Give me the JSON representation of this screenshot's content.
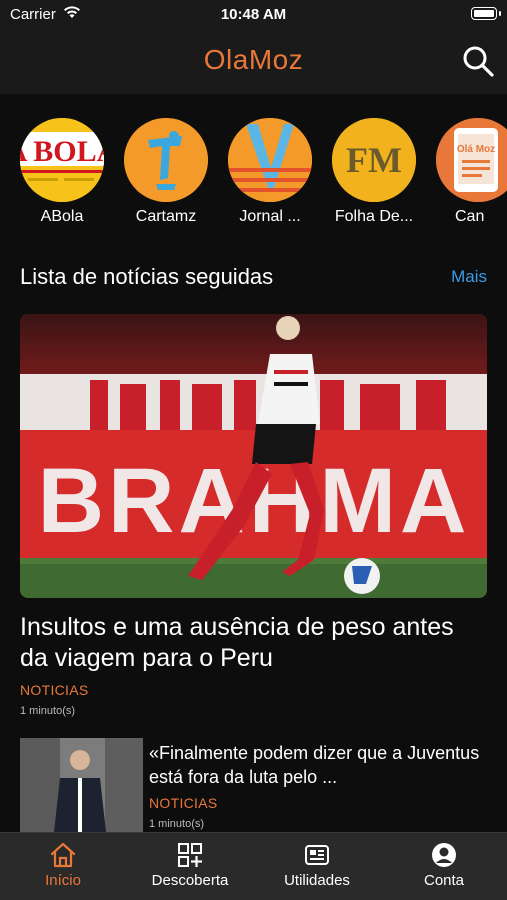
{
  "status_bar": {
    "carrier": "Carrier",
    "time": "10:48 AM"
  },
  "header": {
    "title": "OlaMoz"
  },
  "sources": [
    {
      "name": "ABola",
      "logo_text": "A BOLA"
    },
    {
      "name": "Cartamz"
    },
    {
      "name": "Jornal ..."
    },
    {
      "name": "Folha De...",
      "logo_text": "FM"
    },
    {
      "name": "Can",
      "logo_text": "Olá Moz"
    }
  ],
  "followed": {
    "title": "Lista de notícias seguidas",
    "more_label": "Mais"
  },
  "articles": [
    {
      "title": "Insultos e uma ausência de peso antes da viagem para o Peru",
      "category": "NOTICIAS",
      "time": "1 minuto(s)",
      "image_text": "BRAHMA"
    },
    {
      "title": "«Finalmente podem dizer que a Juventus está fora da luta pelo ...",
      "category": "NOTICIAS",
      "time": "1 minuto(s)"
    }
  ],
  "tabs": [
    {
      "label": "Início",
      "icon": "home-icon"
    },
    {
      "label": "Descoberta",
      "icon": "discover-icon"
    },
    {
      "label": "Utilidades",
      "icon": "utilities-icon"
    },
    {
      "label": "Conta",
      "icon": "account-icon"
    }
  ],
  "colors": {
    "accent": "#e8773a",
    "link": "#3b9ae8",
    "background": "#0d0d0d",
    "bar": "#1a1a1a",
    "tab_bar": "#2a2a2a"
  }
}
